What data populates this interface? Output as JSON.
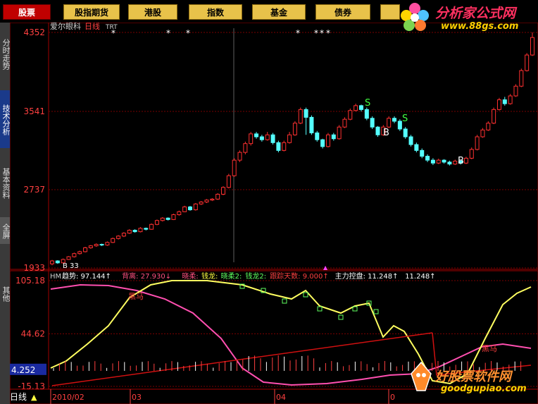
{
  "toolbar": {
    "buttons": [
      {
        "label": "股票",
        "active": true
      },
      {
        "label": "股指期货",
        "active": false
      },
      {
        "label": "港股",
        "active": false
      },
      {
        "label": "指数",
        "active": false
      },
      {
        "label": "基金",
        "active": false
      },
      {
        "label": "债券",
        "active": false
      }
    ]
  },
  "sidebar": {
    "tabs": [
      "分时走势",
      "技术分析",
      "基本资料",
      "全屏",
      "其他"
    ]
  },
  "main_chart": {
    "stock_name": "爱尔眼科",
    "period": "日线",
    "indicator": "TRT",
    "y_ticks": [
      "4352",
      "3541",
      "2737",
      "1933"
    ],
    "signal_labels": {
      "sell": "S",
      "buy": "B"
    },
    "low_marker": "B 33"
  },
  "indicator_panel": {
    "title": "HM",
    "legend": [
      {
        "name": "趋势",
        "value": "97.144",
        "arrow": "↑",
        "color": "#ffffff"
      },
      {
        "name": "背离",
        "value": "27.930",
        "arrow": "↓",
        "color": "#ff5080"
      },
      {
        "name": "晓柔",
        "value": "",
        "arrow": "",
        "color": "#ff5080"
      },
      {
        "name": "钱龙",
        "value": "",
        "arrow": "",
        "color": "#ffff40"
      },
      {
        "name": "晓柔2",
        "value": "",
        "arrow": "",
        "color": "#60ff60"
      },
      {
        "name": "钱龙2",
        "value": "",
        "arrow": "",
        "color": "#60ff60"
      },
      {
        "name": "跟踪天数",
        "value": "9.000",
        "arrow": "↑",
        "color": "#ff4040"
      },
      {
        "name": "主力控盘",
        "value": "11.248",
        "arrow": "↑",
        "color": "#ffffff"
      },
      {
        "name": "",
        "value": "11.248",
        "arrow": "↑",
        "color": "#ffffff"
      }
    ],
    "y_ticks": [
      "105.18",
      "44.62",
      "4.252",
      "-15.13"
    ],
    "label_heima": "黑马"
  },
  "bottom_bar": {
    "period_label": "日线",
    "dates": [
      "2010/02",
      "03",
      "04",
      "0"
    ]
  },
  "watermarks": {
    "top_site": "分析家公式网",
    "top_url": "www.88gs.com",
    "bottom_site": "好股票软件网",
    "bottom_url": "goodgupiao.com"
  },
  "chart_data": {
    "type": "candlestick",
    "title": "爱尔眼科 日线",
    "ylim": [
      1933,
      4352
    ],
    "candles": [
      [
        1975,
        2005,
        1960,
        2015
      ],
      [
        2005,
        1985,
        1975,
        2012
      ],
      [
        1985,
        2020,
        1978,
        2030
      ],
      [
        2020,
        2048,
        2015,
        2055
      ],
      [
        2048,
        2080,
        2040,
        2090
      ],
      [
        2080,
        2100,
        2070,
        2110
      ],
      [
        2100,
        2140,
        2092,
        2150
      ],
      [
        2140,
        2160,
        2130,
        2168
      ],
      [
        2160,
        2175,
        2150,
        2185
      ],
      [
        2175,
        2168,
        2158,
        2182
      ],
      [
        2168,
        2195,
        2160,
        2205
      ],
      [
        2195,
        2235,
        2188,
        2245
      ],
      [
        2235,
        2260,
        2225,
        2270
      ],
      [
        2260,
        2290,
        2250,
        2300
      ],
      [
        2290,
        2320,
        2282,
        2330
      ],
      [
        2320,
        2305,
        2295,
        2330
      ],
      [
        2305,
        2340,
        2298,
        2352
      ],
      [
        2340,
        2330,
        2318,
        2348
      ],
      [
        2330,
        2380,
        2325,
        2390
      ],
      [
        2380,
        2420,
        2372,
        2430
      ],
      [
        2420,
        2445,
        2410,
        2455
      ],
      [
        2445,
        2430,
        2420,
        2452
      ],
      [
        2430,
        2480,
        2425,
        2490
      ],
      [
        2480,
        2510,
        2470,
        2522
      ],
      [
        2510,
        2560,
        2505,
        2572
      ],
      [
        2560,
        2530,
        2520,
        2570
      ],
      [
        2530,
        2590,
        2522,
        2600
      ],
      [
        2590,
        2610,
        2580,
        2620
      ],
      [
        2610,
        2630,
        2600,
        2640
      ],
      [
        2630,
        2640,
        2620,
        2650
      ],
      [
        2640,
        2690,
        2632,
        2700
      ],
      [
        2690,
        2760,
        2680,
        2772
      ],
      [
        2760,
        2880,
        2750,
        2900
      ],
      [
        2880,
        3040,
        2870,
        3060
      ],
      [
        3040,
        3120,
        3020,
        3140
      ],
      [
        3120,
        3210,
        3100,
        3230
      ],
      [
        3210,
        3310,
        3190,
        3330
      ],
      [
        3310,
        3280,
        3260,
        3330
      ],
      [
        3280,
        3250,
        3230,
        3300
      ],
      [
        3250,
        3300,
        3240,
        3330
      ],
      [
        3300,
        3220,
        3200,
        3320
      ],
      [
        3220,
        3140,
        3120,
        3240
      ],
      [
        3140,
        3220,
        3130,
        3240
      ],
      [
        3220,
        3300,
        3210,
        3330
      ],
      [
        3300,
        3420,
        3290,
        3440
      ],
      [
        3420,
        3560,
        3410,
        3580
      ],
      [
        3560,
        3480,
        3300,
        3580
      ],
      [
        3480,
        3320,
        3300,
        3500
      ],
      [
        3320,
        3250,
        3230,
        3340
      ],
      [
        3250,
        3180,
        3160,
        3260
      ],
      [
        3180,
        3300,
        3170,
        3320
      ],
      [
        3300,
        3260,
        3240,
        3320
      ],
      [
        3260,
        3380,
        3250,
        3400
      ],
      [
        3380,
        3460,
        3370,
        3480
      ],
      [
        3460,
        3550,
        3450,
        3570
      ],
      [
        3550,
        3600,
        3540,
        3620
      ],
      [
        3600,
        3560,
        3540,
        3610
      ],
      [
        3560,
        3470,
        3450,
        3580
      ],
      [
        3470,
        3380,
        3360,
        3490
      ],
      [
        3380,
        3300,
        3280,
        3390
      ],
      [
        3300,
        3380,
        3290,
        3400
      ],
      [
        3380,
        3470,
        3370,
        3490
      ],
      [
        3470,
        3440,
        3420,
        3490
      ],
      [
        3440,
        3360,
        3340,
        3460
      ],
      [
        3360,
        3280,
        3260,
        3380
      ],
      [
        3280,
        3200,
        3180,
        3300
      ],
      [
        3200,
        3140,
        3120,
        3220
      ],
      [
        3140,
        3080,
        3060,
        3160
      ],
      [
        3080,
        3040,
        3020,
        3100
      ],
      [
        3040,
        3010,
        2990,
        3060
      ],
      [
        3010,
        3040,
        3000,
        3055
      ],
      [
        3040,
        3020,
        3005,
        3050
      ],
      [
        3020,
        3000,
        2985,
        3035
      ],
      [
        3000,
        3030,
        2990,
        3045
      ],
      [
        3030,
        3010,
        2995,
        3042
      ],
      [
        3010,
        3060,
        3000,
        3075
      ],
      [
        3060,
        3150,
        3050,
        3170
      ],
      [
        3150,
        3280,
        3140,
        3300
      ],
      [
        3280,
        3350,
        3270,
        3370
      ],
      [
        3350,
        3420,
        3340,
        3440
      ],
      [
        3420,
        3560,
        3410,
        3580
      ],
      [
        3560,
        3660,
        3550,
        3680
      ],
      [
        3660,
        3620,
        3600,
        3690
      ],
      [
        3620,
        3700,
        3610,
        3720
      ],
      [
        3700,
        3800,
        3690,
        3820
      ],
      [
        3800,
        3960,
        3790,
        3980
      ],
      [
        3960,
        4120,
        3950,
        4140
      ],
      [
        4120,
        4300,
        4110,
        4352
      ]
    ]
  }
}
